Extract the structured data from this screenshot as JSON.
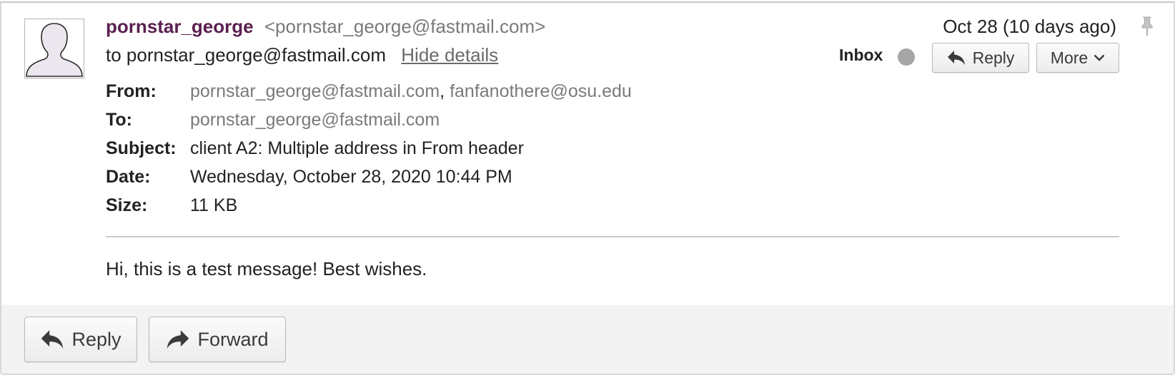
{
  "header": {
    "sender_name": "pornstar_george",
    "sender_email": "<pornstar_george@fastmail.com>",
    "to_line": "to pornstar_george@fastmail.com",
    "hide_details": "Hide details",
    "date_short": "Oct 28 (10 days ago)",
    "mailbox": "Inbox",
    "reply_label": "Reply",
    "more_label": "More"
  },
  "details": {
    "from_label": "From:",
    "from_addr_1": "pornstar_george@fastmail.com",
    "from_separator": ",",
    "from_addr_2": "fanfanothere@osu.edu",
    "to_label": "To:",
    "to_value": "pornstar_george@fastmail.com",
    "subject_label": "Subject:",
    "subject_value": "client A2: Multiple address in From header",
    "date_label": "Date:",
    "date_value": "Wednesday, October 28, 2020 10:44 PM",
    "size_label": "Size:",
    "size_value": "11 KB"
  },
  "body": {
    "text": "Hi, this is a test message! Best wishes."
  },
  "footer": {
    "reply_label": "Reply",
    "forward_label": "Forward"
  },
  "icons": {
    "avatar": "default-avatar-icon",
    "pin": "pin-icon",
    "status": "unread-status-dot",
    "reply": "reply-arrow-icon",
    "forward": "forward-arrow-icon",
    "more": "chevron-down-icon"
  },
  "colors": {
    "sender_name": "#5a1f4f",
    "muted_text": "#7a7a7a",
    "status_dot": "#a6a6a6",
    "footer_bg": "#f3f3f3"
  }
}
